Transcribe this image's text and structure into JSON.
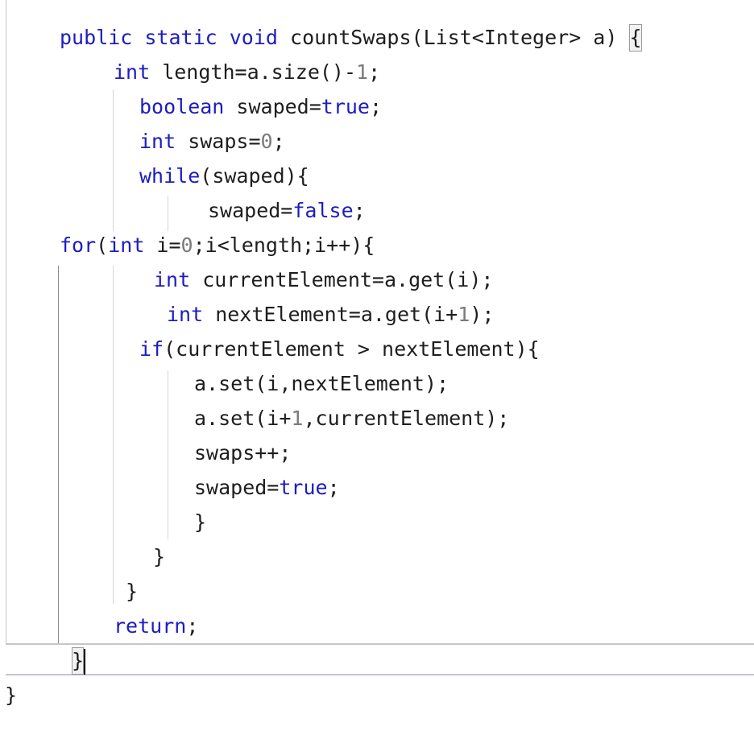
{
  "editor": {
    "lines": {
      "l1": {
        "kw1": "public",
        "kw2": "static",
        "kw3": "void",
        "rest": " countSwaps(List<Integer> a) ",
        "brace": "{"
      },
      "l2": {
        "kw": "int",
        "mid": " length=a.size()-",
        "num": "1",
        "end": ";"
      },
      "l3": {
        "kw": "boolean",
        "mid": " swaped=",
        "kw2": "true",
        "end": ";"
      },
      "l4": {
        "kw": "int",
        "mid": " swaps=",
        "num": "0",
        "end": ";"
      },
      "l5": {
        "kw": "while",
        "rest": "(swaped){"
      },
      "l6": {
        "mid": "swaped=",
        "kw": "false",
        "end": ";"
      },
      "l7": {
        "kw": "for",
        "p1": "(",
        "kw2": "int",
        "mid": " i=",
        "num": "0",
        "rest": ";i<length;i++){"
      },
      "l8": {
        "kw": "int",
        "rest": " currentElement=a.get(i);"
      },
      "l9": {
        "kw": "int",
        "mid": " nextElement=a.get(i+",
        "num": "1",
        "end": ");"
      },
      "l10": {
        "kw": "if",
        "rest": "(currentElement > nextElement){"
      },
      "l11": {
        "text": "a.set(i,nextElement);"
      },
      "l12": {
        "mid": "a.set(i+",
        "num": "1",
        "rest": ",currentElement);"
      },
      "l13": {
        "text": "swaps++;"
      },
      "l14": {
        "mid": "swaped=",
        "kw": "true",
        "end": ";"
      },
      "l15": {
        "text": "}"
      },
      "l16": {
        "text": "}"
      },
      "l17": {
        "text": "}"
      },
      "l18": {
        "kw": "return",
        "end": ";"
      },
      "l19": {
        "brace": "}"
      },
      "l20": {
        "text": "}"
      }
    },
    "colors": {
      "keyword": "#1d1dbf",
      "number": "#7a7a7a",
      "text": "#1e1e1e"
    }
  }
}
